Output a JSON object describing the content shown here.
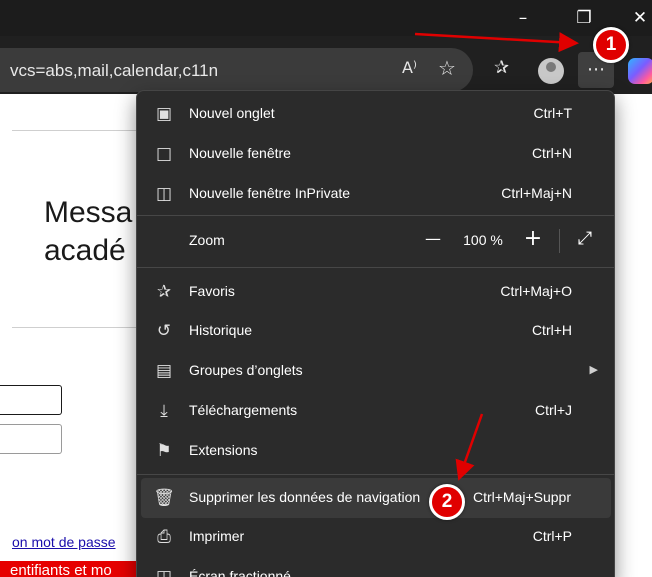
{
  "window": {
    "minimize_icon": "minimize-icon",
    "restore_icon": "restore-icon",
    "close_icon": "close-icon"
  },
  "address_bar": {
    "url_text": "vcs=abs,mail,calendar,c11n"
  },
  "toolbar": {
    "read_aloud_label": "A⁾",
    "icons": [
      "read-aloud-icon",
      "favorite-star-icon",
      "favorites-list-icon",
      "profile-avatar-icon",
      "more-options-icon",
      "copilot-icon"
    ]
  },
  "page": {
    "heading_line1": "Messa",
    "heading_line2": "acadé",
    "link_text": "on mot de passe",
    "error_text": "entifiants et mo"
  },
  "menu": {
    "items": [
      {
        "label": "Nouvel onglet",
        "shortcut": "Ctrl+T",
        "icon": "new-tab-icon"
      },
      {
        "label": "Nouvelle fenêtre",
        "shortcut": "Ctrl+N",
        "icon": "new-window-icon"
      },
      {
        "label": "Nouvelle fenêtre InPrivate",
        "shortcut": "Ctrl+Maj+N",
        "icon": "inprivate-window-icon"
      },
      {
        "label": "Favoris",
        "shortcut": "Ctrl+Maj+O",
        "icon": "favorites-icon"
      },
      {
        "label": "Historique",
        "shortcut": "Ctrl+H",
        "icon": "history-icon"
      },
      {
        "label": "Groupes d’onglets",
        "shortcut": "",
        "icon": "tab-groups-icon"
      },
      {
        "label": "Téléchargements",
        "shortcut": "Ctrl+J",
        "icon": "downloads-icon"
      },
      {
        "label": "Extensions",
        "shortcut": "",
        "icon": "extensions-icon"
      },
      {
        "label": "Supprimer les données de navigation",
        "shortcut": "Ctrl+Maj+Suppr",
        "icon": "trash-icon"
      },
      {
        "label": "Imprimer",
        "shortcut": "Ctrl+P",
        "icon": "print-icon"
      },
      {
        "label": "Écran fractionné",
        "shortcut": "",
        "icon": "split-screen-icon"
      }
    ],
    "zoom": {
      "label": "Zoom",
      "minus": "—",
      "value": "100 %",
      "plus": "+",
      "fullscreen_icon": "fullscreen-icon"
    }
  },
  "annotations": {
    "badge1": "1",
    "badge2": "2",
    "arrow_color": "#e00000"
  },
  "colors": {
    "menu_bg": "#2b2b2b",
    "titlebar_bg": "#1c1c1c",
    "annotation_red": "#e00000"
  }
}
